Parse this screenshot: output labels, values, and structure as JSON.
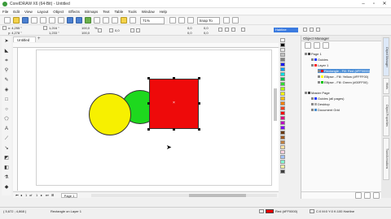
{
  "window": {
    "title": "CorelDRAW X6 (64-Bit) - Untitled"
  },
  "menu": [
    "File",
    "Edit",
    "View",
    "Layout",
    "Object",
    "Effects",
    "Bitmaps",
    "Text",
    "Table",
    "Tools",
    "Window",
    "Help"
  ],
  "stdbar": {
    "zoom": "71%",
    "snap": "Snap To",
    "launch": "Launch"
  },
  "propbar": {
    "x": "x: 4,255 \"",
    "y": "y: 4,278 \"",
    "w": "1,216 \"",
    "h": "1,233 \"",
    "sw": "100,0",
    "sh": "100,0",
    "pct": "%",
    "angle": "0,0",
    "outline": "Hairline"
  },
  "doc": {
    "tab": "Untitled"
  },
  "page_nav": {
    "current": "1",
    "of": "of",
    "total": "1",
    "tab": "Page 1"
  },
  "palette": [
    "#ffffff",
    "#000000",
    "#e8e8e8",
    "#c0c0c0",
    "#808080",
    "#1a1aff",
    "#00a0ff",
    "#00e0e0",
    "#00c050",
    "#30e030",
    "#b0ff00",
    "#ffff00",
    "#ffc000",
    "#ff8000",
    "#ff4020",
    "#ff0000",
    "#e00080",
    "#c000c0",
    "#8000ff",
    "#6a3a10",
    "#a05a20",
    "#c08040",
    "#ffe0a0",
    "#ffd0e0",
    "#a0c0ff",
    "#80ffd0",
    "#f0f0a0",
    "#404040"
  ],
  "object_manager": {
    "title": "Object Manager",
    "rows": [
      {
        "label": "Page 1",
        "color": "#444444",
        "selected": false
      },
      {
        "label": "Guides",
        "color": "#1f3cff",
        "selected": false
      },
      {
        "label": "Layer 1",
        "color": "#ff2020",
        "selected": false
      },
      {
        "label": "Rectangle - Fill: Red (#FF0000)",
        "color": "#ff0000",
        "selected": true
      },
      {
        "label": "Ellipse - Fill: Yellow (#FFFF00)",
        "color": "#ffff00",
        "selected": false
      },
      {
        "label": "Ellipse - Fill: Green (#00FF00)",
        "color": "#00c000",
        "selected": false
      },
      {
        "label": "Master Page",
        "color": "#444444",
        "selected": false
      },
      {
        "label": "Guides (all pages)",
        "color": "#1f3cff",
        "selected": false
      },
      {
        "label": "Desktop",
        "color": "#aaaaaa",
        "selected": false
      },
      {
        "label": "Document Grid",
        "color": "#4a8fd0",
        "selected": false
      }
    ]
  },
  "docker_tabs": [
    "Object Manager",
    "Hints",
    "Object Properties",
    "Transformations"
  ],
  "status": {
    "coords": "( 5,672 ; 4,868 )",
    "object": "Rectangle on Layer 1",
    "fill": "Red (#FF0000)",
    "outline": "C:0 M:0 Y:0 K:100  Hairline",
    "fill_color": "#ff0000"
  }
}
